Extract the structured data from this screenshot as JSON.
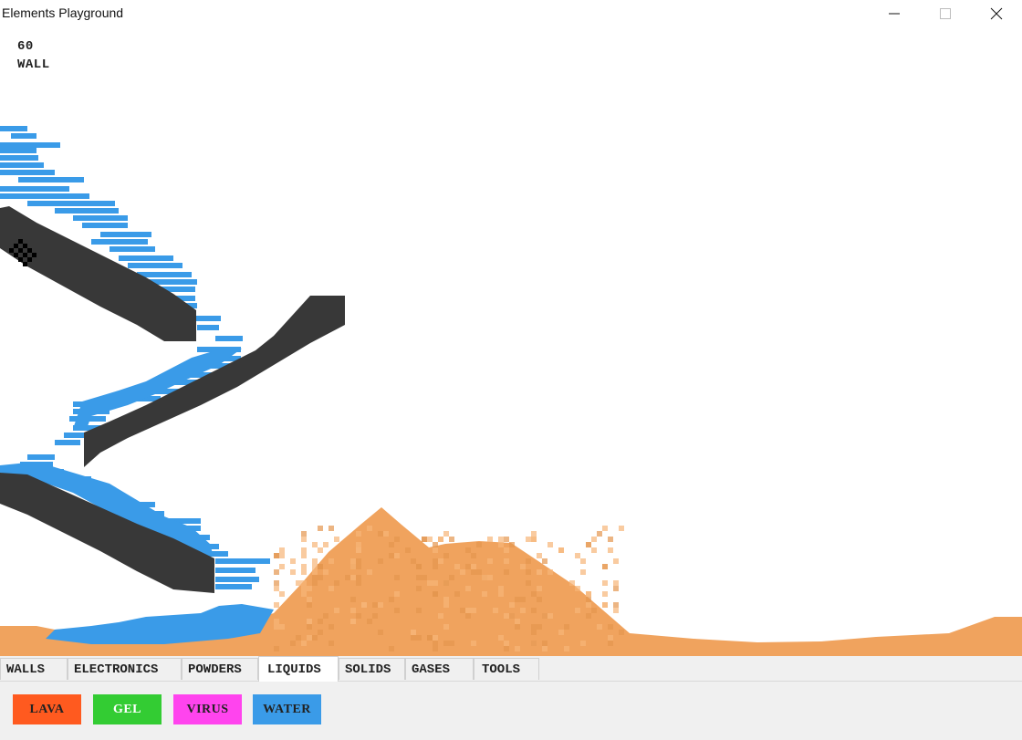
{
  "window": {
    "title": "Elements Playground"
  },
  "hud": {
    "fps": "60",
    "selected_element": "WALL"
  },
  "tabs": [
    {
      "label": "WALLS"
    },
    {
      "label": "ELECTRONICS"
    },
    {
      "label": "POWDERS"
    },
    {
      "label": "LIQUIDS",
      "active": true
    },
    {
      "label": "SOLIDS"
    },
    {
      "label": "GASES"
    },
    {
      "label": "TOOLS"
    }
  ],
  "elements": [
    {
      "label": "LAVA",
      "color": "#ff5a1f",
      "text_color": "#222222"
    },
    {
      "label": "GEL",
      "color": "#33cc33",
      "text_color": "#ffffff"
    },
    {
      "label": "VIRUS",
      "color": "#ff44ee",
      "text_color": "#222222"
    },
    {
      "label": "WATER",
      "color": "#3a9be8",
      "text_color": "#222222"
    }
  ],
  "colors": {
    "wall": "#383838",
    "water": "#3a9be8",
    "sand": "#f0a35e",
    "cursor": "#000000"
  }
}
